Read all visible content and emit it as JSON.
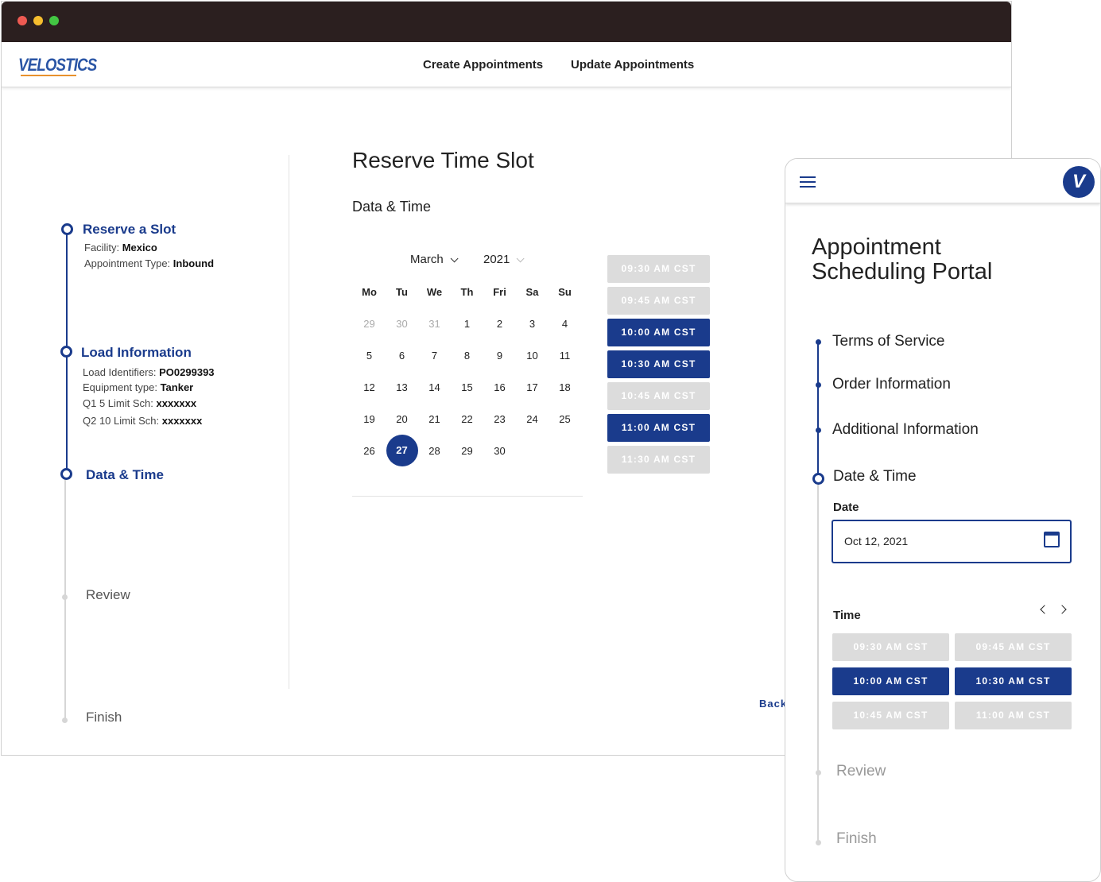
{
  "nav": {
    "logo": "VELOSTICS",
    "links": [
      "Create Appointments",
      "Update Appointments"
    ]
  },
  "stepper": {
    "reserve": {
      "title": "Reserve a Slot",
      "facility_label": "Facility:",
      "facility_value": "Mexico",
      "type_label": "Appointment Type:",
      "type_value": "Inbound"
    },
    "load": {
      "title": "Load Information",
      "ids_label": "Load Identifiers:",
      "ids_value": "PO0299393",
      "equip_label": "Equipment type:",
      "equip_value": "Tanker",
      "q1_label": "Q1 5 Limit Sch:",
      "q1_value": "xxxxxxx",
      "q2_label": "Q2 10 Limit Sch:",
      "q2_value": "xxxxxxx"
    },
    "datetime": "Data & Time",
    "review": "Review",
    "finish": "Finish"
  },
  "main": {
    "title": "Reserve Time Slot",
    "section": "Data & Time",
    "month": "March",
    "year": "2021",
    "weekdays": [
      "Mo",
      "Tu",
      "We",
      "Th",
      "Fri",
      "Sa",
      "Su"
    ],
    "weeks": [
      [
        "29",
        "30",
        "31",
        "1",
        "2",
        "3",
        "4"
      ],
      [
        "5",
        "6",
        "7",
        "8",
        "9",
        "10",
        "11"
      ],
      [
        "12",
        "13",
        "14",
        "15",
        "16",
        "17",
        "18"
      ],
      [
        "19",
        "20",
        "21",
        "22",
        "23",
        "24",
        "25"
      ],
      [
        "26",
        "27",
        "28",
        "29",
        "30",
        "",
        ""
      ]
    ],
    "selected_day": "27",
    "slots": [
      {
        "label": "09:30 AM CST",
        "available": false
      },
      {
        "label": "09:45 AM CST",
        "available": false
      },
      {
        "label": "10:00 AM CST",
        "available": true
      },
      {
        "label": "10:30 AM CST",
        "available": true
      },
      {
        "label": "10:45 AM CST",
        "available": false
      },
      {
        "label": "11:00 AM CST",
        "available": true
      },
      {
        "label": "11:30 AM CST",
        "available": false
      }
    ],
    "back": "Back"
  },
  "mobile": {
    "logo": "V",
    "title_line1": "Appointment",
    "title_line2": "Scheduling Portal",
    "steps": [
      "Terms of Service",
      "Order Information",
      "Additional Information",
      "Date & Time"
    ],
    "date_label": "Date",
    "date_value": "Oct 12, 2021",
    "time_label": "Time",
    "slots": [
      {
        "label": "09:30 AM CST",
        "available": false
      },
      {
        "label": "09:45 AM CST",
        "available": false
      },
      {
        "label": "10:00 AM CST",
        "available": true
      },
      {
        "label": "10:30 AM CST",
        "available": true
      },
      {
        "label": "10:45 AM CST",
        "available": false
      },
      {
        "label": "11:00 AM CST",
        "available": false
      }
    ],
    "review": "Review",
    "finish": "Finish"
  },
  "colors": {
    "primary": "#1a3b8c",
    "disabled": "#dcdcdc",
    "titlebar": "#2b1f1f",
    "logo_accent": "#e8912d"
  }
}
